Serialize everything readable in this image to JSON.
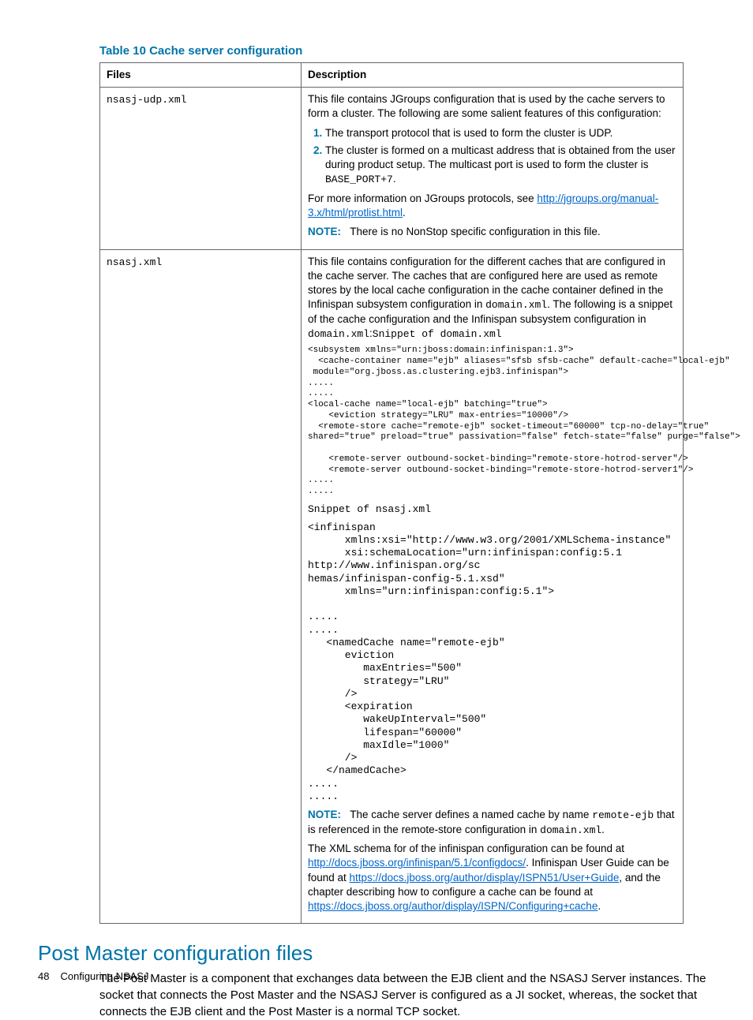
{
  "table": {
    "title": "Table 10 Cache server configuration",
    "header": {
      "files": "Files",
      "description": "Description"
    },
    "rows": [
      {
        "file": "nsasj-udp.xml",
        "intro": "This file contains JGroups configuration that is used by the cache servers to form a cluster. The following are some salient features of this configuration:",
        "li1": "The transport protocol that is used to form the cluster is UDP.",
        "li2_a": "The cluster is formed on a multicast address that is obtained from the user during product setup. The multicast port is used to form the cluster is ",
        "li2_code": "BASE_PORT+7",
        "li2_b": ".",
        "more_a": "For more information on JGroups protocols, see ",
        "more_link": "http://jgroups.org/manual-3.x/html/protlist.html",
        "more_b": ".",
        "note_label": "NOTE:",
        "note_text": "There is no NonStop specific configuration in this file."
      },
      {
        "file": "nsasj.xml",
        "intro_a": "This file contains configuration for the different caches that are configured in the cache server. The caches that are configured here are used as remote stores by the local cache configuration in the cache container defined in the Infinispan subsystem configuration in ",
        "intro_code1": "domain.xml",
        "intro_b": ". The following is a snippet of the cache configuration and the Infinispan subsystem configuration in ",
        "intro_code2": "domain.xml",
        "intro_c": ":",
        "snippet1_label": "Snippet of domain.xml",
        "code1": "<subsystem xmlns=\"urn:jboss:domain:infinispan:1.3\">\n  <cache-container name=\"ejb\" aliases=\"sfsb sfsb-cache\" default-cache=\"local-ejb\"\n module=\"org.jboss.as.clustering.ejb3.infinispan\">\n.....\n.....\n<local-cache name=\"local-ejb\" batching=\"true\">\n    <eviction strategy=\"LRU\" max-entries=\"10000\"/>\n  <remote-store cache=\"remote-ejb\" socket-timeout=\"60000\" tcp-no-delay=\"true\"\nshared=\"true\" preload=\"true\" passivation=\"false\" fetch-state=\"false\" purge=\"false\">\n\n    <remote-server outbound-socket-binding=\"remote-store-hotrod-server\"/>\n    <remote-server outbound-socket-binding=\"remote-store-hotrod-server1\"/>\n.....\n.....",
        "snippet2_label": "Snippet of nsasj.xml",
        "code2": "<infinispan\n      xmlns:xsi=\"http://www.w3.org/2001/XMLSchema-instance\"\n      xsi:schemaLocation=\"urn:infinispan:config:5.1\nhttp://www.infinispan.org/sc\nhemas/infinispan-config-5.1.xsd\"\n      xmlns=\"urn:infinispan:config:5.1\">\n\n.....\n.....\n   <namedCache name=\"remote-ejb\"\n      eviction\n         maxEntries=\"500\"\n         strategy=\"LRU\"\n      />\n      <expiration\n         wakeUpInterval=\"500\"\n         lifespan=\"60000\"\n         maxIdle=\"1000\"\n      />\n   </namedCache>\n.....\n.....",
        "note_label": "NOTE:",
        "note_a": "The cache server defines a named cache by name ",
        "note_code1": "remote-ejb",
        "note_b": " that is referenced in the remote-store configuration in ",
        "note_code2": "domain.xml",
        "note_c": ".",
        "schema_a": "The XML schema for of the infinispan configuration can be found at ",
        "schema_link1": "http://docs.jboss.org/infinispan/5.1/configdocs/",
        "schema_b": ". Infinispan User Guide can be found at ",
        "schema_link2": "https://docs.jboss.org/author/display/ISPN51/User+Guide",
        "schema_c": ", and the chapter describing how to configure a cache can be found at ",
        "schema_link3": "https://docs.jboss.org/author/display/ISPN/Configuring+cache",
        "schema_d": "."
      }
    ]
  },
  "section": {
    "heading": "Post Master configuration files",
    "para": "The Post Master is a component that exchanges data between the EJB client and the NSASJ Server instances. The socket that connects the Post Master and the NSASJ Server is configured as a JI socket, whereas, the socket that connects the EJB client and the Post Master is a normal TCP socket."
  },
  "footer": {
    "page": "48",
    "title": "Configuring NSASJ"
  }
}
